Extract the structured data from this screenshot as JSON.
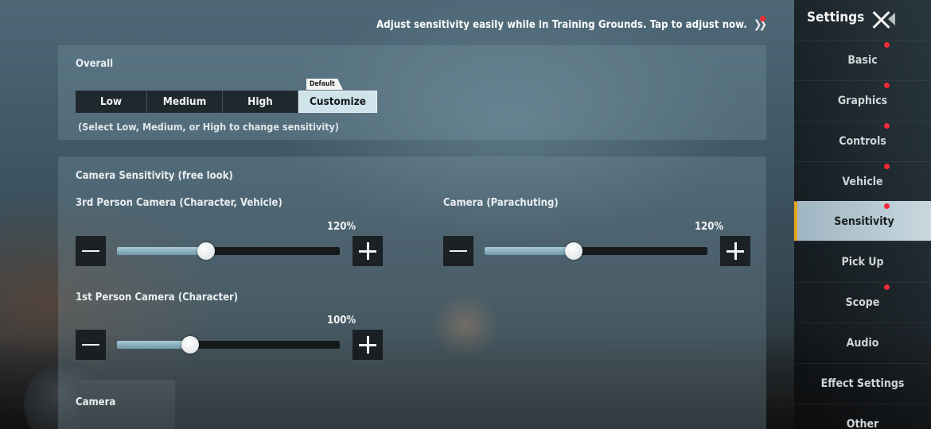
{
  "tip": {
    "text": "Adjust sensitivity easily while in Training Grounds. Tap to adjust now.",
    "arrow": "❯❯"
  },
  "overall": {
    "title": "Overall",
    "options": [
      "Low",
      "Medium",
      "High",
      "Customize"
    ],
    "selected": "Customize",
    "default_tag": "Default",
    "hint": "(Select Low, Medium, or High to change sensitivity)"
  },
  "camera": {
    "section_title": "Camera Sensitivity (free look)",
    "sliders": [
      {
        "label": "3rd Person Camera (Character, Vehicle)",
        "value_text": "120%",
        "level": 0.4
      },
      {
        "label": "Camera (Parachuting)",
        "value_text": "120%",
        "level": 0.4
      },
      {
        "label": "1st Person Camera (Character)",
        "value_text": "100%",
        "level": 0.33
      }
    ],
    "next_label_partial": "Camera"
  },
  "sidebar": {
    "title": "Settings",
    "items": [
      {
        "label": "Basic",
        "badge": true
      },
      {
        "label": "Graphics",
        "badge": true
      },
      {
        "label": "Controls",
        "badge": true
      },
      {
        "label": "Vehicle",
        "badge": true
      },
      {
        "label": "Sensitivity",
        "badge": true
      },
      {
        "label": "Pick Up",
        "badge": false
      },
      {
        "label": "Scope",
        "badge": true
      },
      {
        "label": "Audio",
        "badge": false
      },
      {
        "label": "Effect Settings",
        "badge": false
      },
      {
        "label": "Other",
        "badge": false
      }
    ],
    "active": "Sensitivity"
  },
  "colors": {
    "accent": "#e7a51e",
    "badge": "#ef2b36",
    "selected_option": "#cfe3ea"
  }
}
